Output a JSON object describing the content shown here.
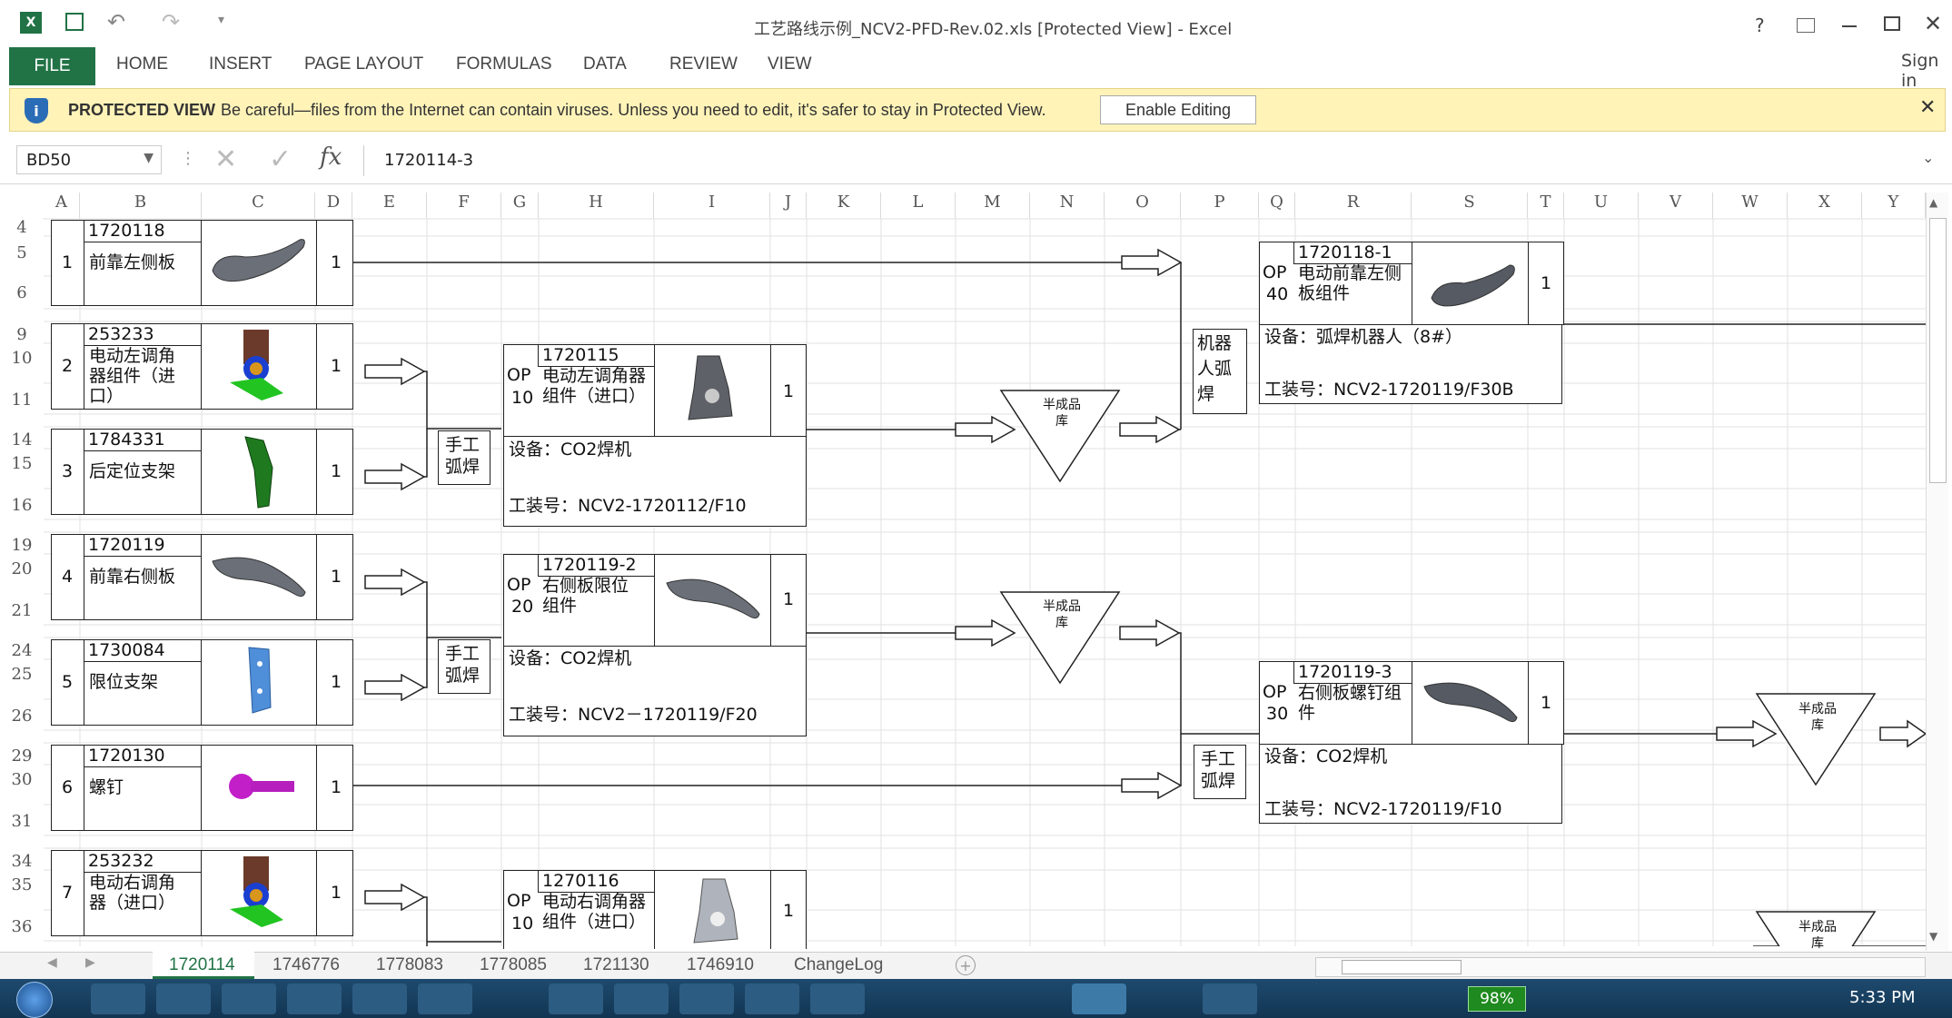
{
  "window": {
    "title": "工艺路线示例_NCV2-PFD-Rev.02.xls  [Protected View] - Excel",
    "help": "?",
    "sign_in": "Sign in"
  },
  "ribbon": {
    "file": "FILE",
    "tabs": [
      "HOME",
      "INSERT",
      "PAGE LAYOUT",
      "FORMULAS",
      "DATA",
      "REVIEW",
      "VIEW"
    ]
  },
  "protected": {
    "label": "PROTECTED VIEW",
    "message": "Be careful—files from the Internet can contain viruses. Unless you need to edit, it's safer to stay in Protected View.",
    "button": "Enable Editing"
  },
  "formula_bar": {
    "name_box": "BD50",
    "fx": "fx",
    "value": "1720114-3"
  },
  "columns": [
    "A",
    "B",
    "C",
    "D",
    "E",
    "F",
    "G",
    "H",
    "I",
    "J",
    "K",
    "L",
    "M",
    "N",
    "O",
    "P",
    "Q",
    "R",
    "S",
    "T",
    "U",
    "V",
    "W",
    "X",
    "Y"
  ],
  "rows": [
    "4",
    "5",
    "6",
    "9",
    "10",
    "11",
    "14",
    "15",
    "16",
    "19",
    "20",
    "21",
    "24",
    "25",
    "26",
    "29",
    "30",
    "31",
    "34",
    "35",
    "36"
  ],
  "parts": [
    {
      "num": "1",
      "code": "1720118",
      "name": "前靠左侧板",
      "qty": "1"
    },
    {
      "num": "2",
      "code": "253233",
      "name": "电动左调角器组件（进口）",
      "qty": "1"
    },
    {
      "num": "3",
      "code": "1784331",
      "name": "后定位支架",
      "qty": "1"
    },
    {
      "num": "4",
      "code": "1720119",
      "name": "前靠右侧板",
      "qty": "1"
    },
    {
      "num": "5",
      "code": "1730084",
      "name": "限位支架",
      "qty": "1"
    },
    {
      "num": "6",
      "code": "1720130",
      "name": "螺钉",
      "qty": "1"
    },
    {
      "num": "7",
      "code": "253232",
      "name": "电动右调角器（进口）",
      "qty": "1"
    }
  ],
  "ops": [
    {
      "op": "OP",
      "opnum": "10",
      "code": "1720115",
      "name": "电动左调角器组件（进口）",
      "qty": "1",
      "equip": "设备：CO2焊机",
      "fixture": "工装号：NCV2-1720112/F10"
    },
    {
      "op": "OP",
      "opnum": "20",
      "code": "1720119-2",
      "name": "右侧板限位组件",
      "qty": "1",
      "equip": "设备：CO2焊机",
      "fixture": "工装号：NCV2－1720119/F20"
    },
    {
      "op": "OP",
      "opnum": "40",
      "code": "1720118-1",
      "name": "电动前靠左侧板组件",
      "qty": "1",
      "equip": "设备：弧焊机器人（8#）",
      "fixture": "工装号：NCV2-1720119/F30B"
    },
    {
      "op": "OP",
      "opnum": "30",
      "code": "1720119-3",
      "name": "右侧板螺钉组件",
      "qty": "1",
      "equip": "设备：CO2焊机",
      "fixture": "工装号：NCV2-1720119/F10"
    },
    {
      "op": "OP",
      "opnum": "10",
      "code": "1270116",
      "name": "电动右调角器组件（进口）",
      "qty": "1"
    }
  ],
  "process": {
    "manual": "手工弧焊",
    "robot": "机器人弧焊",
    "wip": "半成品库"
  },
  "sheets": [
    "1720114",
    "1746776",
    "1778083",
    "1778085",
    "1721130",
    "1746910",
    "ChangeLog"
  ],
  "taskbar": {
    "battery": "98%",
    "time": "5:33 PM"
  }
}
